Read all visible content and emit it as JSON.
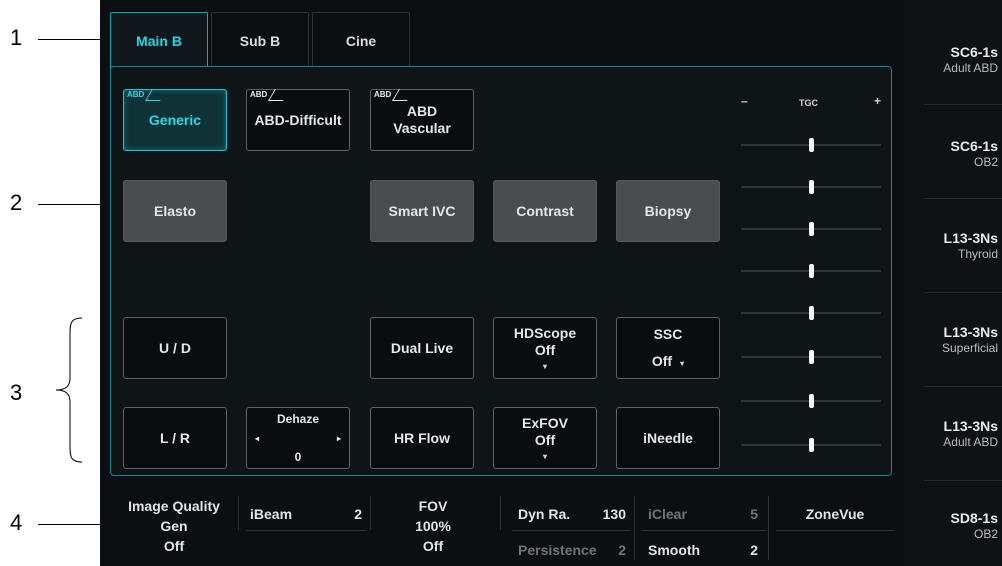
{
  "callouts": [
    "1",
    "2",
    "3",
    "4"
  ],
  "tabs": [
    "Main B",
    "Sub B",
    "Cine"
  ],
  "exam_presets": {
    "tag": "ABD",
    "generic": "Generic",
    "difficult": "ABD-Difficult",
    "vascular_line1": "ABD",
    "vascular_line2": "Vascular"
  },
  "features": {
    "elasto": "Elasto",
    "smart_ivc": "Smart IVC",
    "contrast": "Contrast",
    "biopsy": "Biopsy"
  },
  "controls": {
    "ud": "U / D",
    "lr": "L / R",
    "dual_live": "Dual Live",
    "hr_flow": "HR Flow",
    "hdscope_label": "HDScope",
    "hdscope_value": "Off",
    "exfov_label": "ExFOV",
    "exfov_value": "Off",
    "ssc_label": "SSC",
    "ssc_value": "Off",
    "ineedle": "iNeedle",
    "dehaze_label": "Dehaze",
    "dehaze_value": "0",
    "arrow_down": "▾",
    "arrow_left": "◂",
    "arrow_right": "▸"
  },
  "tgc": {
    "label": "TGC",
    "minus": "–",
    "plus": "+",
    "levels": [
      0.5,
      0.5,
      0.5,
      0.5,
      0.5,
      0.5,
      0.5,
      0.5
    ]
  },
  "probes": [
    {
      "name": "SC6-1s",
      "preset": "Adult ABD"
    },
    {
      "name": "SC6-1s",
      "preset": "OB2"
    },
    {
      "name": "L13-3Ns",
      "preset": "Thyroid"
    },
    {
      "name": "L13-3Ns",
      "preset": "Superficial"
    },
    {
      "name": "L13-3Ns",
      "preset": "Adult ABD"
    },
    {
      "name": "SD8-1s",
      "preset": "OB2"
    }
  ],
  "bottom": {
    "image_quality_line1": "Image Quality",
    "image_quality_line2": "Gen",
    "image_quality_line3": "Off",
    "ibeam_label": "iBeam",
    "ibeam_value": "2",
    "fov_label": "FOV",
    "fov_value": "100%",
    "fov_state": "Off",
    "dynra_label": "Dyn Ra.",
    "dynra_value": "130",
    "persistence_label": "Persistence",
    "persistence_value": "2",
    "iclear_label": "iClear",
    "iclear_value": "5",
    "smooth_label": "Smooth",
    "smooth_value": "2",
    "zonevue": "ZoneVue"
  },
  "colors": {
    "accent": "#20d8e4",
    "panel_border": "#118a96",
    "screen_bg": "#0c0f11"
  }
}
